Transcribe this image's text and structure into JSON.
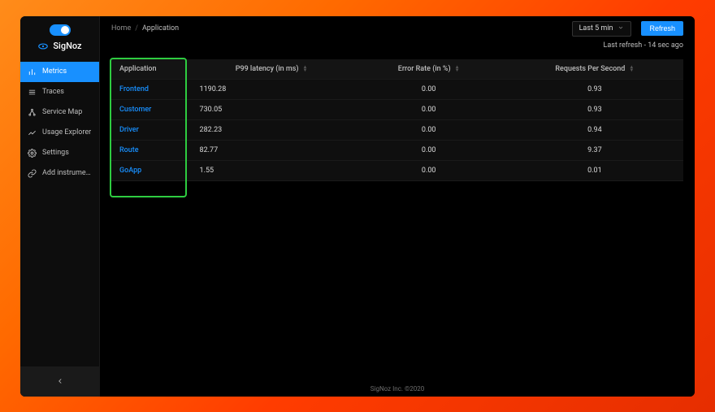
{
  "brand": {
    "name": "SigNoz"
  },
  "sidebar": {
    "items": [
      {
        "label": "Metrics"
      },
      {
        "label": "Traces"
      },
      {
        "label": "Service Map"
      },
      {
        "label": "Usage Explorer"
      },
      {
        "label": "Settings"
      },
      {
        "label": "Add instrume…"
      }
    ]
  },
  "breadcrumb": {
    "home": "Home",
    "sep": "/",
    "current": "Application"
  },
  "timePicker": {
    "label": "Last 5 min"
  },
  "refresh": {
    "label": "Refresh"
  },
  "lastRefresh": "Last refresh - 14 sec ago",
  "table": {
    "headers": {
      "app": "Application",
      "p99": "P99 latency (in ms)",
      "err": "Error Rate (in %)",
      "rps": "Requests Per Second"
    },
    "rows": [
      {
        "app": "Frontend",
        "p99": "1190.28",
        "err": "0.00",
        "rps": "0.93"
      },
      {
        "app": "Customer",
        "p99": "730.05",
        "err": "0.00",
        "rps": "0.93"
      },
      {
        "app": "Driver",
        "p99": "282.23",
        "err": "0.00",
        "rps": "0.94"
      },
      {
        "app": "Route",
        "p99": "82.77",
        "err": "0.00",
        "rps": "9.37"
      },
      {
        "app": "GoApp",
        "p99": "1.55",
        "err": "0.00",
        "rps": "0.01"
      }
    ]
  },
  "footer": "SigNoz Inc. ©2020"
}
